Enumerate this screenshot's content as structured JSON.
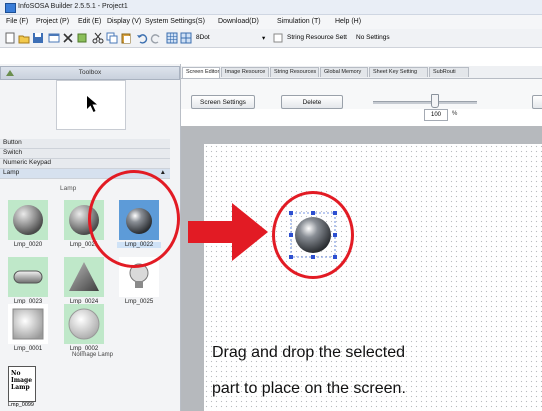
{
  "window": {
    "title": "InfoSOSA Builder 2.5.5.1 - Project1"
  },
  "menu": [
    "File (F)",
    "Project (P)",
    "Edit (E)",
    "Display (V)",
    "System Settings(S)",
    "Download(D)",
    "Simulation (T)",
    "Help (H)"
  ],
  "toolbar": {
    "dot_label": "8Dot",
    "string_resource_label": "String Resource Sett",
    "string_resource_value": "No Settings"
  },
  "toolbox": {
    "title": "Toolbox",
    "categories": [
      "Button",
      "Switch",
      "Numeric Keypad",
      "Lamp"
    ],
    "lamp_group_label": "Lamp",
    "parts": [
      "Lmp_0020",
      "Lmp_0021",
      "Lmp_0022",
      "Lmp_0023",
      "Lmp_0024",
      "Lmp_0025",
      "Lmp_0001",
      "Lmp_0002"
    ],
    "noimage_group_label": "NoImage Lamp",
    "noimage_part": "Lmp_0099",
    "noimage_thumb_text": "No Image Lamp"
  },
  "tabs": [
    "Screen Editor",
    "Image Resource",
    "String Resources",
    "Global Memory",
    "Sheet Key Setting",
    "SubRouti"
  ],
  "editor": {
    "screen_settings_label": "Screen Settings",
    "delete_label": "Delete",
    "zoom_value": "100",
    "zoom_unit": "%"
  },
  "caption": {
    "line1": "Drag and drop the selected",
    "line2": "part to place on the screen."
  },
  "colors": {
    "annotation_red": "#e21b24",
    "selected_blue": "#5d9bd8",
    "lamp_bg_green": "#bfe8c9"
  }
}
